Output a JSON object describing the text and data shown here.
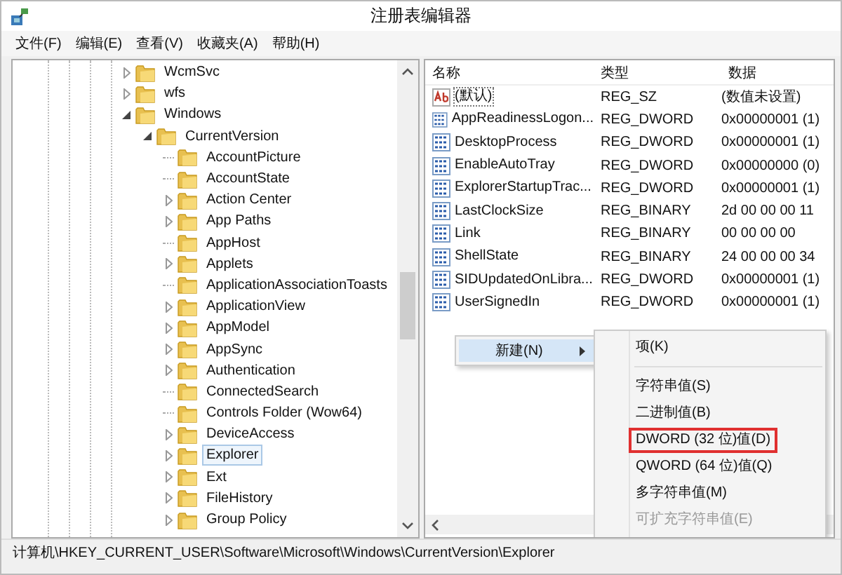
{
  "window": {
    "title": "注册表编辑器"
  },
  "menu": [
    "文件(F)",
    "编辑(E)",
    "查看(V)",
    "收藏夹(A)",
    "帮助(H)"
  ],
  "tree": [
    {
      "label": "WcmSvc",
      "expanded": false,
      "selected": false
    },
    {
      "label": "wfs",
      "expanded": false,
      "selected": false
    },
    {
      "label": "Windows",
      "expanded": true,
      "selected": false,
      "children": [
        {
          "label": "CurrentVersion",
          "expanded": true,
          "selected": false,
          "children": [
            {
              "label": "AccountPicture",
              "leaf": true,
              "selected": false
            },
            {
              "label": "AccountState",
              "leaf": true,
              "selected": false
            },
            {
              "label": "Action Center",
              "expanded": false,
              "selected": false
            },
            {
              "label": "App Paths",
              "expanded": false,
              "selected": false
            },
            {
              "label": "AppHost",
              "leaf": true,
              "selected": false
            },
            {
              "label": "Applets",
              "expanded": false,
              "selected": false
            },
            {
              "label": "ApplicationAssociationToasts",
              "leaf": true,
              "selected": false
            },
            {
              "label": "ApplicationView",
              "expanded": false,
              "selected": false
            },
            {
              "label": "AppModel",
              "expanded": false,
              "selected": false
            },
            {
              "label": "AppSync",
              "expanded": false,
              "selected": false
            },
            {
              "label": "Authentication",
              "expanded": false,
              "selected": false
            },
            {
              "label": "ConnectedSearch",
              "leaf": true,
              "selected": false
            },
            {
              "label": "Controls Folder (Wow64)",
              "leaf": true,
              "selected": false
            },
            {
              "label": "DeviceAccess",
              "expanded": false,
              "selected": false
            },
            {
              "label": "Explorer",
              "expanded": false,
              "selected": true
            },
            {
              "label": "Ext",
              "expanded": false,
              "selected": false
            },
            {
              "label": "FileHistory",
              "expanded": false,
              "selected": false
            },
            {
              "label": "Group Policy",
              "expanded": false,
              "selected": false
            }
          ]
        }
      ]
    }
  ],
  "values": {
    "columns": [
      "名称",
      "类型",
      "数据"
    ],
    "rows": [
      {
        "kind": "string",
        "name": "(默认)",
        "type": "REG_SZ",
        "data": "(数值未设置)",
        "selected": true
      },
      {
        "kind": "binary",
        "name": "AppReadinessLogon...",
        "type": "REG_DWORD",
        "data": "0x00000001 (1)",
        "selected": false
      },
      {
        "kind": "binary",
        "name": "DesktopProcess",
        "type": "REG_DWORD",
        "data": "0x00000001 (1)",
        "selected": false
      },
      {
        "kind": "binary",
        "name": "EnableAutoTray",
        "type": "REG_DWORD",
        "data": "0x00000000 (0)",
        "selected": false
      },
      {
        "kind": "binary",
        "name": "ExplorerStartupTrac...",
        "type": "REG_DWORD",
        "data": "0x00000001 (1)",
        "selected": false
      },
      {
        "kind": "binary",
        "name": "LastClockSize",
        "type": "REG_BINARY",
        "data": "2d 00 00 00 11",
        "selected": false
      },
      {
        "kind": "binary",
        "name": "Link",
        "type": "REG_BINARY",
        "data": "00 00 00 00",
        "selected": false
      },
      {
        "kind": "binary",
        "name": "ShellState",
        "type": "REG_BINARY",
        "data": "24 00 00 00 34",
        "selected": false
      },
      {
        "kind": "binary",
        "name": "SIDUpdatedOnLibra...",
        "type": "REG_DWORD",
        "data": "0x00000001 (1)",
        "selected": false
      },
      {
        "kind": "binary",
        "name": "UserSignedIn",
        "type": "REG_DWORD",
        "data": "0x00000001 (1)",
        "selected": false
      }
    ]
  },
  "context_menu": {
    "items": [
      {
        "label": "新建(N)",
        "selected": true
      }
    ]
  },
  "submenu": {
    "items": [
      {
        "label": "项(K)",
        "highlighted": false,
        "disabled": false
      },
      {
        "kind": "separator"
      },
      {
        "label": "字符串值(S)",
        "highlighted": false,
        "disabled": false
      },
      {
        "label": "二进制值(B)",
        "highlighted": false,
        "disabled": false
      },
      {
        "label": "DWORD (32 位)值(D)",
        "highlighted": true,
        "disabled": false
      },
      {
        "label": "QWORD (64 位)值(Q)",
        "highlighted": false,
        "disabled": false
      },
      {
        "label": "多字符串值(M)",
        "highlighted": false,
        "disabled": false
      },
      {
        "label": "可扩充字符串值(E)",
        "highlighted": false,
        "disabled": true
      }
    ]
  },
  "status_bar": "计算机\\HKEY_CURRENT_USER\\Software\\Microsoft\\Windows\\CurrentVersion\\Explorer"
}
